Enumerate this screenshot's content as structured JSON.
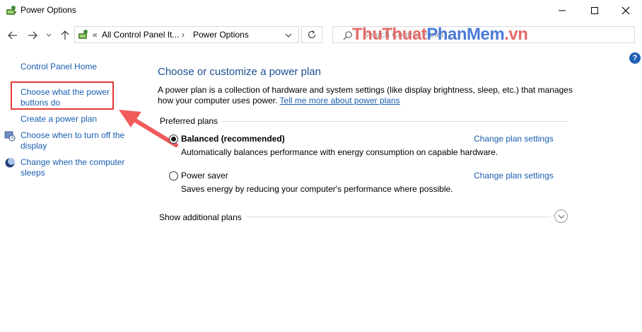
{
  "window": {
    "title": "Power Options",
    "icons": {
      "app": "power-options-icon",
      "minimize": "minimize-icon",
      "maximize": "maximize-icon",
      "close": "close-icon"
    }
  },
  "address": {
    "back_icon": "back-arrow-icon",
    "forward_icon": "forward-arrow-icon",
    "recent_icon": "chevron-down-icon",
    "up_icon": "up-arrow-icon",
    "overflow": "«",
    "crumb1": "All Control Panel It...",
    "separator": "›",
    "crumb2": "Power Options",
    "search_placeholder": "Search Control Panel"
  },
  "watermark": {
    "part1": "ThuThuat",
    "part2": "PhanMem",
    "part3": ".vn"
  },
  "help_label": "?",
  "sidebar": {
    "home": "Control Panel Home",
    "power_buttons": [
      "Choose what the power",
      "buttons do"
    ],
    "create_plan": "Create a power plan",
    "display_off": [
      "Choose when to turn off the",
      "display"
    ],
    "sleep": [
      "Change when the computer",
      "sleeps"
    ]
  },
  "main": {
    "title": "Choose or customize a power plan",
    "description_line1": "A power plan is a collection of hardware and system settings (like display brightness, sleep, etc.) that manages",
    "description_line2": "how your computer uses power.",
    "learn_more": "Tell me more about power plans",
    "preferred_label": "Preferred plans",
    "plans": [
      {
        "name": "Balanced (recommended)",
        "description": "Automatically balances performance with energy consumption on capable hardware.",
        "link": "Change plan settings",
        "selected": true
      },
      {
        "name": "Power saver",
        "description": "Saves energy by reducing your computer's performance where possible.",
        "link": "Change plan settings",
        "selected": false
      }
    ],
    "show_more": "Show additional plans"
  },
  "colors": {
    "link": "#1a5eb0",
    "title": "#1d4f91",
    "highlight": "#e53935",
    "arrow": "#f05a5a"
  }
}
